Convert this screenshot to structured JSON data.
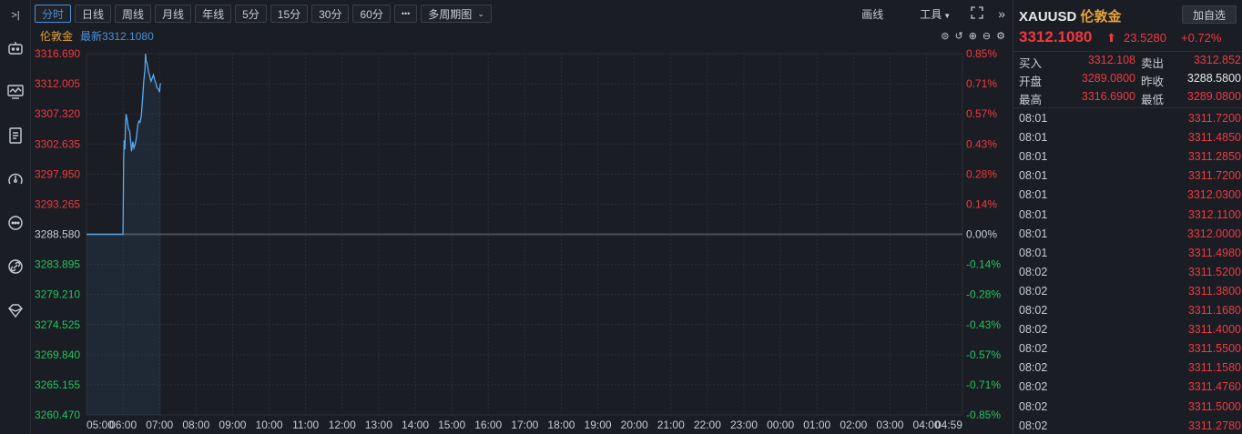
{
  "toolbar": {
    "collapse": ">|",
    "periods": [
      "分时",
      "日线",
      "周线",
      "月线",
      "年线",
      "5分",
      "15分",
      "30分",
      "60分"
    ],
    "more": "•••",
    "multi": "多周期图",
    "draw": "画线",
    "tools": "工具",
    "fullscreen_icon": "fullscreen-icon",
    "expand": "»"
  },
  "chart_header": {
    "name": "伦敦金",
    "latest": "最新3312.1080"
  },
  "panel": {
    "symbol": "XAUUSD",
    "name": "伦敦金",
    "add_button": "加自选",
    "price": "3312.1080",
    "change": "23.5280",
    "change_pct": "+0.72%",
    "quotes": [
      {
        "l1": "买入",
        "v1": "3312.108",
        "l2": "卖出",
        "v2": "3312.852",
        "c2": "red"
      },
      {
        "l1": "开盘",
        "v1": "3289.0800",
        "l2": "昨收",
        "v2": "3288.5800",
        "c2": "white"
      },
      {
        "l1": "最高",
        "v1": "3316.6900",
        "l2": "最低",
        "v2": "3289.0800",
        "c2": "red"
      }
    ],
    "ticks": [
      {
        "t": "08:01",
        "p": "3311.7200"
      },
      {
        "t": "08:01",
        "p": "3311.4850"
      },
      {
        "t": "08:01",
        "p": "3311.2850"
      },
      {
        "t": "08:01",
        "p": "3311.7200"
      },
      {
        "t": "08:01",
        "p": "3312.0300"
      },
      {
        "t": "08:01",
        "p": "3312.1100"
      },
      {
        "t": "08:01",
        "p": "3312.0000"
      },
      {
        "t": "08:01",
        "p": "3311.4980"
      },
      {
        "t": "08:02",
        "p": "3311.5200"
      },
      {
        "t": "08:02",
        "p": "3311.3800"
      },
      {
        "t": "08:02",
        "p": "3311.1680"
      },
      {
        "t": "08:02",
        "p": "3311.4000"
      },
      {
        "t": "08:02",
        "p": "3311.5500"
      },
      {
        "t": "08:02",
        "p": "3311.1580"
      },
      {
        "t": "08:02",
        "p": "3311.4760"
      },
      {
        "t": "08:02",
        "p": "3311.5000"
      },
      {
        "t": "08:02",
        "p": "3311.2780"
      }
    ]
  },
  "chart_data": {
    "type": "line",
    "prev_close": 3288.58,
    "ylim": [
      3260.47,
      3316.69
    ],
    "y_ticks": [
      "3316.690",
      "3312.005",
      "3307.320",
      "3302.635",
      "3297.950",
      "3293.265",
      "3288.580",
      "3283.895",
      "3279.210",
      "3274.525",
      "3269.840",
      "3265.155",
      "3260.470"
    ],
    "pct_ticks": [
      "0.85%",
      "0.71%",
      "0.57%",
      "0.43%",
      "0.28%",
      "0.14%",
      "0.00%",
      "-0.14%",
      "-0.28%",
      "-0.43%",
      "-0.57%",
      "-0.71%",
      "-0.85%"
    ],
    "x_ticks": [
      "05:00",
      "06:00",
      "07:00",
      "08:00",
      "09:00",
      "10:00",
      "11:00",
      "12:00",
      "13:00",
      "14:00",
      "15:00",
      "16:00",
      "17:00",
      "18:00",
      "19:00",
      "20:00",
      "21:00",
      "22:00",
      "23:00",
      "00:00",
      "01:00",
      "02:00",
      "03:00",
      "04:00",
      "04:59"
    ],
    "series": [
      {
        "values": [
          [
            0,
            3288.58
          ],
          [
            60,
            3288.58
          ],
          [
            61,
            3300.5
          ],
          [
            62,
            3303.2
          ],
          [
            63,
            3301.8
          ],
          [
            64,
            3305.5
          ],
          [
            65,
            3307.3
          ],
          [
            67,
            3306.2
          ],
          [
            69,
            3305.0
          ],
          [
            71,
            3304.6
          ],
          [
            73,
            3302.6
          ],
          [
            74,
            3301.5
          ],
          [
            76,
            3303.0
          ],
          [
            78,
            3302.0
          ],
          [
            80,
            3302.6
          ],
          [
            82,
            3303.6
          ],
          [
            84,
            3305.5
          ],
          [
            86,
            3306.2
          ],
          [
            88,
            3306.0
          ],
          [
            90,
            3307.0
          ],
          [
            92,
            3309.5
          ],
          [
            94,
            3312.3
          ],
          [
            96,
            3314.2
          ],
          [
            97,
            3316.69
          ],
          [
            98,
            3315.6
          ],
          [
            100,
            3315.0
          ],
          [
            102,
            3313.8
          ],
          [
            104,
            3313.2
          ],
          [
            106,
            3312.4
          ],
          [
            108,
            3312.9
          ],
          [
            110,
            3313.4
          ],
          [
            112,
            3312.6
          ],
          [
            114,
            3312.1
          ],
          [
            116,
            3311.4
          ],
          [
            118,
            3311.2
          ],
          [
            120,
            3310.7
          ],
          [
            121,
            3311.9
          ],
          [
            122,
            3312.1
          ]
        ]
      }
    ]
  }
}
